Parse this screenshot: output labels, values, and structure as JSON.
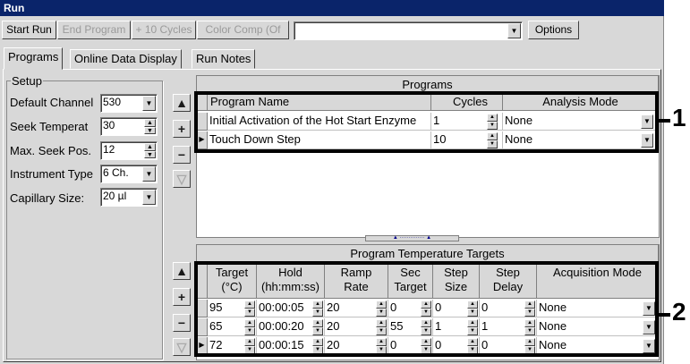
{
  "window": {
    "title": "Run"
  },
  "toolbar": {
    "start_run": "Start Run",
    "end_program": "End Program",
    "plus_10_cycles": "+ 10 Cycles",
    "color_comp": "Color Comp (Of",
    "program_select_value": "",
    "options": "Options"
  },
  "tabs": [
    "Programs",
    "Online Data Display",
    "Run Notes"
  ],
  "setup": {
    "title": "Setup",
    "default_channel_label": "Default Channel",
    "default_channel_value": "530",
    "seek_temp_label": "Seek Temperat",
    "seek_temp_value": "30",
    "max_seek_label": "Max. Seek Pos.",
    "max_seek_value": "12",
    "instrument_type_label": "Instrument Type",
    "instrument_type_value": "6 Ch.",
    "capillary_size_label": "Capillary Size:",
    "capillary_size_value": "20 µl"
  },
  "programs": {
    "title": "Programs",
    "headers": [
      "Program Name",
      "Cycles",
      "Analysis Mode"
    ],
    "rows": [
      {
        "name": "Initial Activation of the Hot Start Enzyme",
        "cycles": "1",
        "mode": "None"
      },
      {
        "name": "Touch Down Step",
        "cycles": "10",
        "mode": "None"
      }
    ]
  },
  "targets": {
    "title": "Program Temperature Targets",
    "headers": {
      "target": [
        "Target",
        "(°C)"
      ],
      "hold": [
        "Hold",
        "(hh:mm:ss)"
      ],
      "ramp": [
        "Ramp",
        "Rate"
      ],
      "sec": [
        "Sec",
        "Target"
      ],
      "step_size": [
        "Step",
        "Size"
      ],
      "step_delay": [
        "Step",
        "Delay"
      ],
      "acq": [
        "Acquisition Mode",
        ""
      ]
    },
    "rows": [
      {
        "target": "95",
        "hold": "00:00:05",
        "ramp": "20",
        "sec": "0",
        "size": "0",
        "delay": "0",
        "acq": "None"
      },
      {
        "target": "65",
        "hold": "00:00:20",
        "ramp": "20",
        "sec": "55",
        "size": "1",
        "delay": "1",
        "acq": "None"
      },
      {
        "target": "72",
        "hold": "00:00:15",
        "ramp": "20",
        "sec": "0",
        "size": "0",
        "delay": "0",
        "acq": "None"
      }
    ]
  },
  "callouts": [
    "1",
    "2"
  ],
  "icons": {
    "up": "triangle-up-icon",
    "add": "plus-icon",
    "remove": "minus-icon",
    "down": "triangle-down-icon",
    "dropdown": "chevron-down-icon",
    "row_pointer": "triangle-right-icon"
  }
}
